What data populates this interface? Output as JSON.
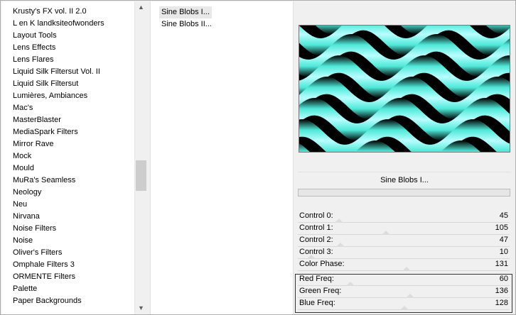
{
  "categories": [
    "Krusty's FX vol. II 2.0",
    "L en K landksiteofwonders",
    "Layout Tools",
    "Lens Effects",
    "Lens Flares",
    "Liquid Silk Filtersut Vol. II",
    "Liquid Silk Filtersut",
    "Lumières, Ambiances",
    "Mac's",
    "MasterBlaster",
    "MediaSpark Filters",
    "Mirror Rave",
    "Mock",
    "Mould",
    "MuRa's Seamless",
    "Neology",
    "Neu",
    "Nirvana",
    "Noise Filters",
    "Noise",
    "Oliver's Filters",
    "Omphale Filters 3",
    "ORMENTE Filters",
    "Palette",
    "Paper Backgrounds"
  ],
  "filters": [
    "Sine Blobs I...",
    "Sine Blobs II..."
  ],
  "selected_filter": "Sine Blobs I...",
  "controls": [
    {
      "label": "Control 0:",
      "value": 45
    },
    {
      "label": "Control 1:",
      "value": 105
    },
    {
      "label": "Control 2:",
      "value": 47
    },
    {
      "label": "Control 3:",
      "value": 10
    },
    {
      "label": "Color Phase:",
      "value": 131
    },
    {
      "label": "Red Freq:",
      "value": 60
    },
    {
      "label": "Green Freq:",
      "value": 136
    },
    {
      "label": "Blue Freq:",
      "value": 128
    }
  ],
  "slider_max": 255,
  "preview_colors": {
    "primary": "#4ee8d8",
    "dark": "#000000",
    "highlight": "#b8ffff"
  },
  "icons": {
    "scroll_up": "scroll-up-icon",
    "scroll_down": "scroll-down-icon"
  },
  "glyphs": {
    "up": "▲",
    "down": "▼"
  }
}
